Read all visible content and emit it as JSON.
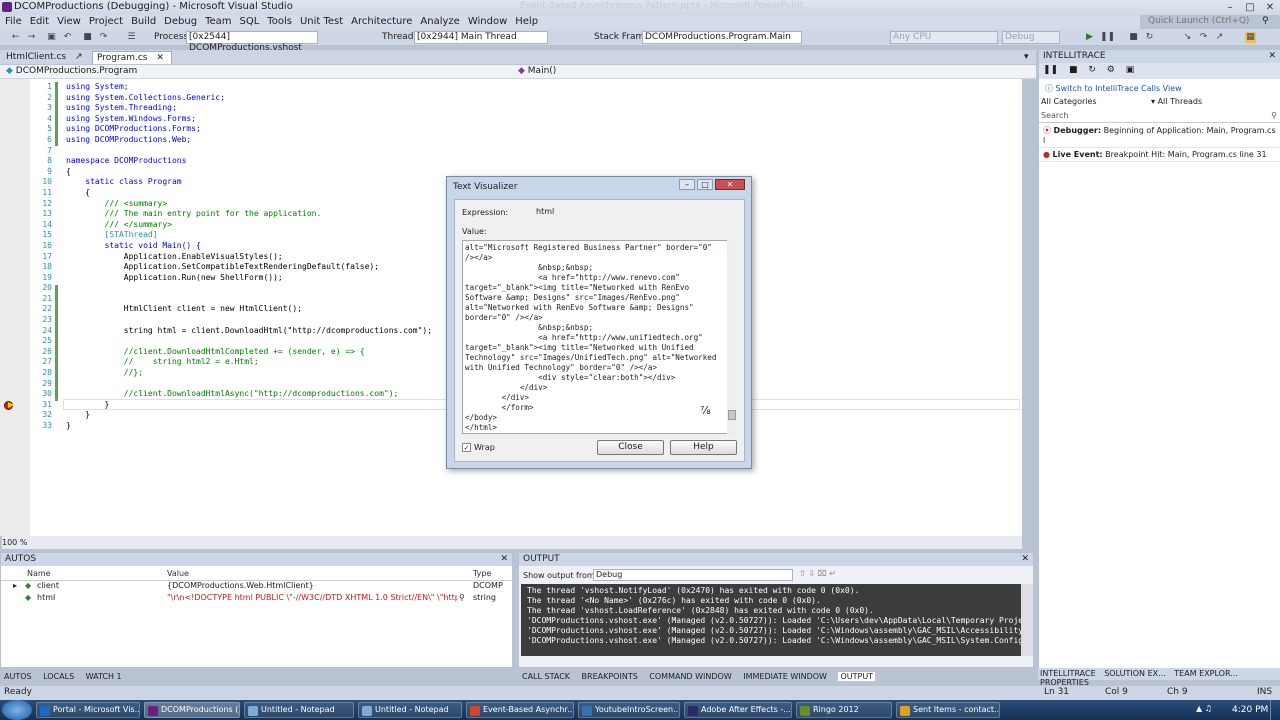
{
  "window": {
    "title": "DCOMProductions (Debugging) - Microsoft Visual Studio",
    "faded_title": "Event-Based Asynchronous Pattern.pptx - Microsoft PowerPoint"
  },
  "quick_launch": {
    "placeholder": "Quick Launch (Ctrl+Q)"
  },
  "menu": [
    "File",
    "Edit",
    "View",
    "Project",
    "Build",
    "Debug",
    "Team",
    "SQL",
    "Tools",
    "Unit Test",
    "Architecture",
    "Analyze",
    "Window",
    "Help"
  ],
  "toolbar": {
    "process_label": "Process:",
    "process_value": "[0x2544] DCOMProductions.vshost",
    "thread_label": "Thread:",
    "thread_value": "[0x2944] Main Thread",
    "stackframe_label": "Stack Frame:",
    "stackframe_value": "DCOMProductions.Program.Main",
    "platform_value": "Any CPU",
    "config_value": "Debug"
  },
  "tabs": [
    {
      "label": "HtmlClient.cs"
    },
    {
      "label": "Program.cs"
    }
  ],
  "nav": {
    "type": "DCOMProductions.Program",
    "member": "Main()"
  },
  "editor": {
    "zoom": "100 %",
    "line_numbers": [
      "1",
      "2",
      "3",
      "4",
      "5",
      "6",
      "7",
      "8",
      "9",
      "10",
      "11",
      "12",
      "13",
      "14",
      "15",
      "16",
      "17",
      "18",
      "19",
      "20",
      "21",
      "22",
      "23",
      "24",
      "25",
      "26",
      "27",
      "28",
      "29",
      "30",
      "31",
      "32",
      "33"
    ],
    "lines": [
      "using System;",
      "using System.Collections.Generic;",
      "using System.Threading;",
      "using System.Windows.Forms;",
      "using DCOMProductions.Forms;",
      "using DCOMProductions.Web;",
      "",
      "namespace DCOMProductions",
      "{",
      "    static class Program",
      "    {",
      "        /// <summary>",
      "        /// The main entry point for the application.",
      "        /// </summary>",
      "        [STAThread]",
      "        static void Main() {",
      "            Application.EnableVisualStyles();",
      "            Application.SetCompatibleTextRenderingDefault(false);",
      "            Application.Run(new ShellForm());",
      "",
      "",
      "            HtmlClient client = new HtmlClient();",
      "",
      "            string html = client.DownloadHtml(\"http://dcomproductions.com\");",
      "",
      "            //client.DownloadHtmlCompleted += (sender, e) => {",
      "            //    string html2 = e.Html;",
      "            //};",
      "",
      "            //client.DownloadHtmlAsync(\"http://dcomproductions.com\");",
      "        }",
      "    }",
      "}"
    ]
  },
  "visualizer": {
    "title": "Text Visualizer",
    "expression_label": "Expression:",
    "expression_value": "html",
    "value_label": "Value:",
    "value_lines": [
      "alt=\"Microsoft Registered Business Partner\" border=\"0\"",
      "/></a>",
      "                &nbsp;&nbsp;",
      "                <a href=\"http://www.renevo.com\"",
      "target=\"_blank\"><img title=\"Networked with RenEvo",
      "Software &amp; Designs\" src=\"Images/RenEvo.png\"",
      "alt=\"Networked with RenEvo Software &amp; Designs\"",
      "border=\"0\" /></a>",
      "                &nbsp;&nbsp;",
      "                <a href=\"http://www.unifiedtech.org\"",
      "target=\"_blank\"><img title=\"Networked with Unified",
      "Technology\" src=\"Images/UnifiedTech.png\" alt=\"Networked",
      "with Unified Technology\" border=\"0\" /></a>",
      "                <div style=\"clear:both\"></div>",
      "            </div>",
      "        </div>",
      "        </form>",
      "</body>",
      "</html>"
    ],
    "wrap_label": "Wrap",
    "close_label": "Close",
    "help_label": "Help"
  },
  "autos": {
    "title": "AUTOS",
    "headers": [
      "Name",
      "Value",
      "Type"
    ],
    "rows": [
      {
        "name": "client",
        "value": "{DCOMProductions.Web.HtmlClient}",
        "type": "DCOMP"
      },
      {
        "name": "html",
        "value": "\"\\r\\n<!DOCTYPE html PUBLIC \\\"-//W3C//DTD XHTML 1.0 Strict//EN\\\" \\\"http://w",
        "type": "string"
      }
    ],
    "tabs": [
      "AUTOS",
      "LOCALS",
      "WATCH 1"
    ]
  },
  "output": {
    "title": "OUTPUT",
    "show_label": "Show output from:",
    "show_value": "Debug",
    "lines": [
      "The thread 'vshost.NotifyLoad' (0x2470) has exited with code 0 (0x0).",
      "The thread '<No Name>' (0x276c) has exited with code 0 (0x0).",
      "The thread 'vshost.LoadReference' (0x2848) has exited with code 0 (0x0).",
      "'DCOMProductions.vshost.exe' (Managed (v2.0.50727)): Loaded 'C:\\Users\\dev\\AppData\\Local\\Temporary Projects",
      "'DCOMProductions.vshost.exe' (Managed (v2.0.50727)): Loaded 'C:\\Windows\\assembly\\GAC_MSIL\\Accessibility\\2.",
      "'DCOMProductions.vshost.exe' (Managed (v2.0.50727)): Loaded 'C:\\Windows\\assembly\\GAC_MSIL\\System.Configura"
    ],
    "tabs": [
      "CALL STACK",
      "BREAKPOINTS",
      "COMMAND WINDOW",
      "IMMEDIATE WINDOW",
      "OUTPUT"
    ]
  },
  "intellitrace": {
    "title": "INTELLITRACE",
    "switch_link": "Switch to IntelliTrace Calls View",
    "categories": "All Categories",
    "threads": "All Threads",
    "search_placeholder": "Search",
    "events": [
      {
        "bold": "Debugger:",
        "text": "Beginning of Application: Main, Program.cs l"
      },
      {
        "bold": "Live Event:",
        "text": "Breakpoint Hit: Main, Program.cs line 31"
      }
    ],
    "tabs": [
      "INTELLITRACE",
      "SOLUTION EX...",
      "TEAM EXPLOR...",
      "PROPERTIES"
    ]
  },
  "status": {
    "left": "Ready",
    "ln": "Ln 31",
    "col": "Col 9",
    "ch": "Ch 9",
    "mode": "INS"
  },
  "taskbar": {
    "items": [
      {
        "label": "Portal - Microsoft Vis...",
        "color": "#1c6bc0"
      },
      {
        "label": "DCOMProductions (...",
        "color": "#68217a"
      },
      {
        "label": "Untitled - Notepad",
        "color": "#7fa9d8"
      },
      {
        "label": "Untitled - Notepad",
        "color": "#7fa9d8"
      },
      {
        "label": "Event-Based Asynchr...",
        "color": "#d24726"
      },
      {
        "label": "YoutubeIntroScreen...",
        "color": "#3a6fb0"
      },
      {
        "label": "Adobe After Effects -...",
        "color": "#2a2a6a"
      },
      {
        "label": "Ringo 2012",
        "color": "#6b8e23"
      },
      {
        "label": "Sent Items - contact...",
        "color": "#e0a020"
      }
    ],
    "clock": "4:20 PM"
  }
}
